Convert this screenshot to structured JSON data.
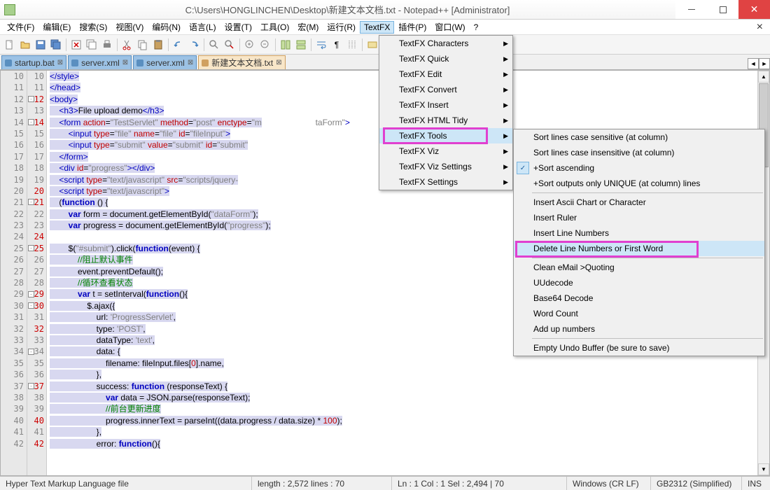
{
  "window": {
    "title": "C:\\Users\\HONGLINCHEN\\Desktop\\新建文本文档.txt - Notepad++ [Administrator]"
  },
  "menubar": {
    "items": [
      "文件(F)",
      "编辑(E)",
      "搜索(S)",
      "视图(V)",
      "编码(N)",
      "语言(L)",
      "设置(T)",
      "工具(O)",
      "宏(M)",
      "运行(R)",
      "TextFX",
      "插件(P)",
      "窗口(W)",
      "?"
    ],
    "active_index": 10
  },
  "tabs": {
    "items": [
      {
        "label": "startup.bat",
        "active": false
      },
      {
        "label": "server.xml",
        "active": false
      },
      {
        "label": "server.xml",
        "active": false
      },
      {
        "label": "新建文本文档.txt",
        "active": true
      }
    ]
  },
  "gutter_main": [
    "10",
    "11",
    "12",
    "13",
    "14",
    "15",
    "16",
    "17",
    "18",
    "19",
    "20",
    "21",
    "22",
    "23",
    "24",
    "25",
    "26",
    "27",
    "28",
    "29",
    "30",
    "31",
    "32",
    "33",
    "34",
    "35",
    "36",
    "37",
    "38",
    "39",
    "40",
    "41",
    "42"
  ],
  "gutter_inner": [
    {
      "n": "10",
      "r": false
    },
    {
      "n": "11",
      "r": false
    },
    {
      "n": "12",
      "r": true
    },
    {
      "n": "13",
      "r": false
    },
    {
      "n": "14",
      "r": true
    },
    {
      "n": "15",
      "r": false
    },
    {
      "n": "16",
      "r": false
    },
    {
      "n": "17",
      "r": false
    },
    {
      "n": "18",
      "r": false
    },
    {
      "n": "19",
      "r": false
    },
    {
      "n": "20",
      "r": true
    },
    {
      "n": "21",
      "r": true
    },
    {
      "n": "22",
      "r": false
    },
    {
      "n": "23",
      "r": false
    },
    {
      "n": "24",
      "r": true
    },
    {
      "n": "25",
      "r": true
    },
    {
      "n": "26",
      "r": false
    },
    {
      "n": "27",
      "r": false
    },
    {
      "n": "28",
      "r": false
    },
    {
      "n": "29",
      "r": true
    },
    {
      "n": "30",
      "r": true
    },
    {
      "n": "31",
      "r": false
    },
    {
      "n": "32",
      "r": true
    },
    {
      "n": "33",
      "r": false
    },
    {
      "n": "34",
      "r": false
    },
    {
      "n": "35",
      "r": false
    },
    {
      "n": "36",
      "r": false
    },
    {
      "n": "37",
      "r": true
    },
    {
      "n": "38",
      "r": false
    },
    {
      "n": "39",
      "r": false
    },
    {
      "n": "40",
      "r": true
    },
    {
      "n": "41",
      "r": false
    },
    {
      "n": "42",
      "r": true
    }
  ],
  "menu1": {
    "items": [
      {
        "label": "TextFX Characters",
        "arrow": true
      },
      {
        "label": "TextFX Quick",
        "arrow": true
      },
      {
        "label": "TextFX Edit",
        "arrow": true
      },
      {
        "label": "TextFX Convert",
        "arrow": true
      },
      {
        "label": "TextFX Insert",
        "arrow": true
      },
      {
        "label": "TextFX HTML Tidy",
        "arrow": true
      },
      {
        "label": "TextFX Tools",
        "arrow": true,
        "hl": true
      },
      {
        "label": "TextFX Viz",
        "arrow": true
      },
      {
        "label": "TextFX Viz Settings",
        "arrow": true
      },
      {
        "label": "TextFX Settings",
        "arrow": true
      }
    ]
  },
  "menu2": {
    "items": [
      {
        "label": "Sort lines case sensitive (at column)"
      },
      {
        "label": "Sort lines case insensitive (at column)"
      },
      {
        "label": "+Sort ascending",
        "check": true
      },
      {
        "label": "+Sort outputs only UNIQUE (at column) lines"
      },
      {
        "sep": true
      },
      {
        "label": "Insert Ascii Chart or Character"
      },
      {
        "label": "Insert Ruler"
      },
      {
        "label": "Insert Line Numbers"
      },
      {
        "label": "Delete Line Numbers or First Word",
        "hl": true
      },
      {
        "sep": true
      },
      {
        "label": "Clean eMail >Quoting"
      },
      {
        "label": "UUdecode"
      },
      {
        "label": "Base64 Decode"
      },
      {
        "label": "Word Count"
      },
      {
        "label": "Add up numbers"
      },
      {
        "sep": true
      },
      {
        "label": "Empty Undo Buffer (be sure to save)"
      }
    ]
  },
  "status": {
    "filetype": "Hyper Text Markup Language file",
    "length": "length : 2,572    lines : 70",
    "pos": "Ln : 1    Col : 1    Sel : 2,494 | 70",
    "eol": "Windows (CR LF)",
    "enc": "GB2312 (Simplified)",
    "ins": "INS"
  }
}
